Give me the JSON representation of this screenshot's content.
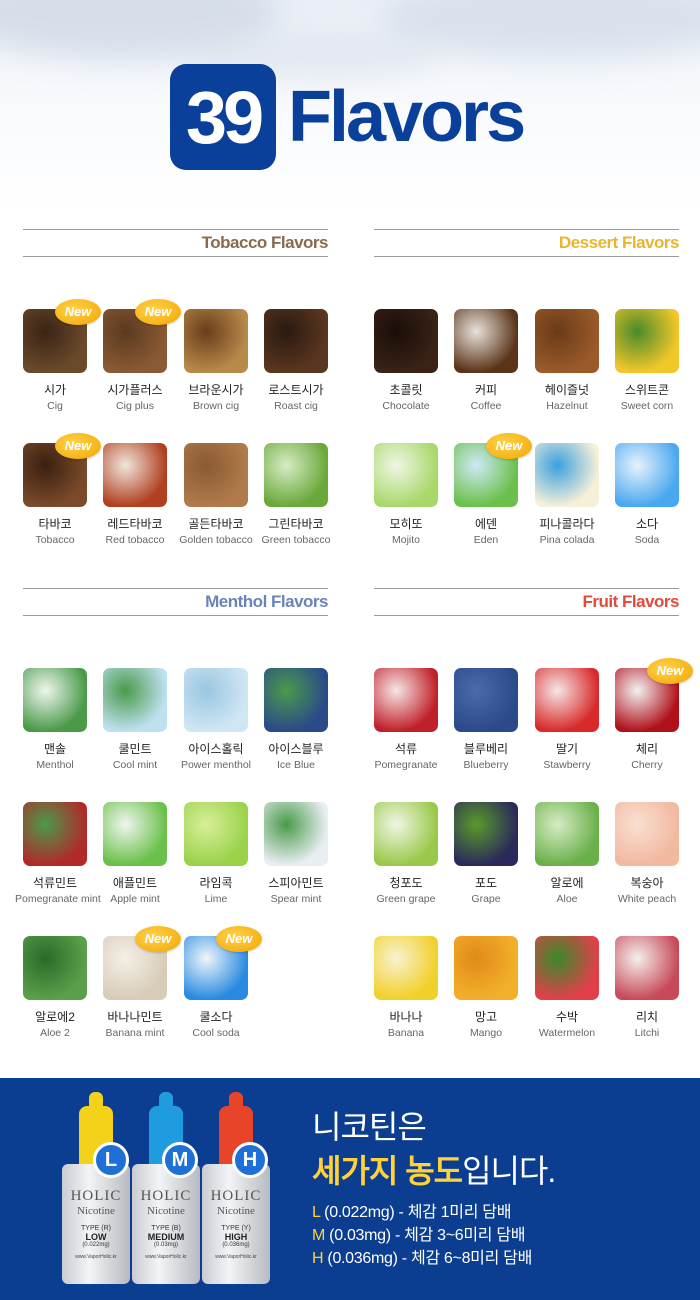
{
  "header": {
    "number": "39",
    "word": "Flavors"
  },
  "sections": {
    "tobacco": {
      "title": "Tobacco Flavors",
      "color": "#8a6a4e",
      "items": [
        {
          "ko": "시가",
          "en": "Cig",
          "new": true
        },
        {
          "ko": "시가플러스",
          "en": "Cig plus",
          "new": true
        },
        {
          "ko": "브라운시가",
          "en": "Brown cig",
          "new": false
        },
        {
          "ko": "로스트시가",
          "en": "Roast cig",
          "new": false
        },
        {
          "ko": "타바코",
          "en": "Tobacco",
          "new": true
        },
        {
          "ko": "레드타바코",
          "en": "Red tobacco",
          "new": false
        },
        {
          "ko": "골든타바코",
          "en": "Golden tobacco",
          "new": false
        },
        {
          "ko": "그린타바코",
          "en": "Green tobacco",
          "new": false
        }
      ]
    },
    "dessert": {
      "title": "Dessert Flavors",
      "color": "#e9b52a",
      "items": [
        {
          "ko": "초콜릿",
          "en": "Chocolate",
          "new": false
        },
        {
          "ko": "커피",
          "en": "Coffee",
          "new": false
        },
        {
          "ko": "헤이즐넛",
          "en": "Hazelnut",
          "new": false
        },
        {
          "ko": "스위트콘",
          "en": "Sweet corn",
          "new": false
        },
        {
          "ko": "모히또",
          "en": "Mojito",
          "new": false
        },
        {
          "ko": "에덴",
          "en": "Eden",
          "new": true
        },
        {
          "ko": "피나콜라다",
          "en": "Pina colada",
          "new": false
        },
        {
          "ko": "소다",
          "en": "Soda",
          "new": false
        }
      ]
    },
    "menthol": {
      "title": "Menthol Flavors",
      "color": "#6a84b8",
      "items": [
        {
          "ko": "맨솔",
          "en": "Menthol",
          "new": false
        },
        {
          "ko": "쿨민트",
          "en": "Cool mint",
          "new": false
        },
        {
          "ko": "아이스홀릭",
          "en": "Power menthol",
          "new": false
        },
        {
          "ko": "아이스블루",
          "en": "Ice Blue",
          "new": false
        },
        {
          "ko": "석류민트",
          "en": "Pomegranate mint",
          "new": false
        },
        {
          "ko": "애플민트",
          "en": "Apple mint",
          "new": false
        },
        {
          "ko": "라임콕",
          "en": "Lime",
          "new": false
        },
        {
          "ko": "스피아민트",
          "en": "Spear mint",
          "new": false
        },
        {
          "ko": "알로에2",
          "en": "Aloe 2",
          "new": false
        },
        {
          "ko": "바나나민트",
          "en": "Banana mint",
          "new": true
        },
        {
          "ko": "쿨소다",
          "en": "Cool soda",
          "new": true
        }
      ]
    },
    "fruit": {
      "title": "Fruit Flavors",
      "color": "#e24a3c",
      "items": [
        {
          "ko": "석류",
          "en": "Pomegranate",
          "new": false
        },
        {
          "ko": "블루베리",
          "en": "Blueberry",
          "new": false
        },
        {
          "ko": "딸기",
          "en": "Stawberry",
          "new": false
        },
        {
          "ko": "체리",
          "en": "Cherry",
          "new": true
        },
        {
          "ko": "청포도",
          "en": "Green grape",
          "new": false
        },
        {
          "ko": "포도",
          "en": "Grape",
          "new": false
        },
        {
          "ko": "알로에",
          "en": "Aloe",
          "new": false
        },
        {
          "ko": "복숭아",
          "en": "White peach",
          "new": false
        },
        {
          "ko": "바나나",
          "en": "Banana",
          "new": false
        },
        {
          "ko": "망고",
          "en": "Mango",
          "new": false
        },
        {
          "ko": "수박",
          "en": "Watermelon",
          "new": false
        },
        {
          "ko": "리치",
          "en": "Litchi",
          "new": false
        }
      ]
    }
  },
  "new_label": "New",
  "footer": {
    "line1": "니코틴은",
    "line2_highlight": "세가지 농도",
    "line2_rest": "입니다.",
    "specs": [
      {
        "key": "L",
        "text": " (0.022mg) - 체감 1미리 담배"
      },
      {
        "key": "M",
        "text": " (0.03mg) - 체감 3~6미리 담배"
      },
      {
        "key": "H",
        "text": " (0.036mg) - 체감 6~8미리 담배"
      }
    ],
    "bottles": [
      {
        "letter": "L",
        "brand": "HOLIC",
        "sub": "Nicotine",
        "type": "TYPE (R)",
        "level": "LOW",
        "mg": "(0.022mg)",
        "web": "www.VaporHolic.kr",
        "cap_color": "#f4d21a"
      },
      {
        "letter": "M",
        "brand": "HOLIC",
        "sub": "Nicotine",
        "type": "TYPE (B)",
        "level": "MEDIUM",
        "mg": "(0.03mg)",
        "web": "www.VaporHolic.kr",
        "cap_color": "#1f9be0"
      },
      {
        "letter": "H",
        "brand": "HOLIC",
        "sub": "Nicotine",
        "type": "TYPE (Y)",
        "level": "HIGH",
        "mg": "(0.036mg)",
        "web": "www.VaporHolic.kr",
        "cap_color": "#e8442a"
      }
    ]
  }
}
